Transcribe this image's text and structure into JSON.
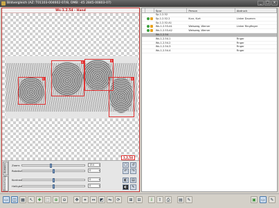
{
  "window": {
    "title": "Bildvergleich (AZ: T01103-004602-07/8, OMB: -45 2845-00803-07)",
    "buttons": [
      "_",
      "□",
      "×"
    ]
  },
  "image_panel": {
    "title": "Ws-1.2.54 - Hand",
    "scale_tag": "1,2,54",
    "rois": [
      "1",
      "2",
      "3",
      "4"
    ]
  },
  "controls": {
    "tabs": [
      "Auswahl",
      "Bearbeitung"
    ],
    "zoom_label": "Zoom:",
    "zoom_value": "154",
    "rotation_label": "Rotation:",
    "rotation_value": "0",
    "contrast_label": "Kontrast:",
    "contrast_value": "0",
    "brightness_label": "Helligkeit:",
    "brightness_value": "0"
  },
  "table": {
    "headers": [
      "Spur",
      "Person",
      "Abdruck"
    ],
    "rows": [
      {
        "spur": "Sp-1.2.52",
        "person": "",
        "abdruck": "",
        "icons": []
      },
      {
        "spur": "Sp-1.2.52.2",
        "person": "Kurz, Kurt",
        "abdruck": "Linker Daumen",
        "icons": [
          "g",
          "o"
        ]
      },
      {
        "spur": "Sp-1.2.52.A1",
        "person": "",
        "abdruck": "",
        "icons": []
      },
      {
        "spur": "Ws-1.2.53.A1",
        "person": "Weisweg, Werner",
        "abdruck": "Linker Ringfinger",
        "icons": [
          "g",
          "o"
        ]
      },
      {
        "spur": "Ws-1.2.53.A2",
        "person": "Weisweg, Werner",
        "abdruck": "",
        "icons": [
          "g",
          "o"
        ]
      },
      {
        "spur": "Ws-1.2.54",
        "person": "",
        "abdruck": "",
        "icons": [],
        "selected": true
      },
      {
        "spur": "Ws-1.2.54.1",
        "person": "",
        "abdruck": "Finger",
        "icons": []
      },
      {
        "spur": "Ws-1.2.54.2",
        "person": "",
        "abdruck": "Finger",
        "icons": []
      },
      {
        "spur": "Ws-1.2.54.3",
        "person": "",
        "abdruck": "Finger",
        "icons": []
      },
      {
        "spur": "Ws-1.2.54.4",
        "person": "",
        "abdruck": "Finger",
        "icons": []
      }
    ]
  }
}
